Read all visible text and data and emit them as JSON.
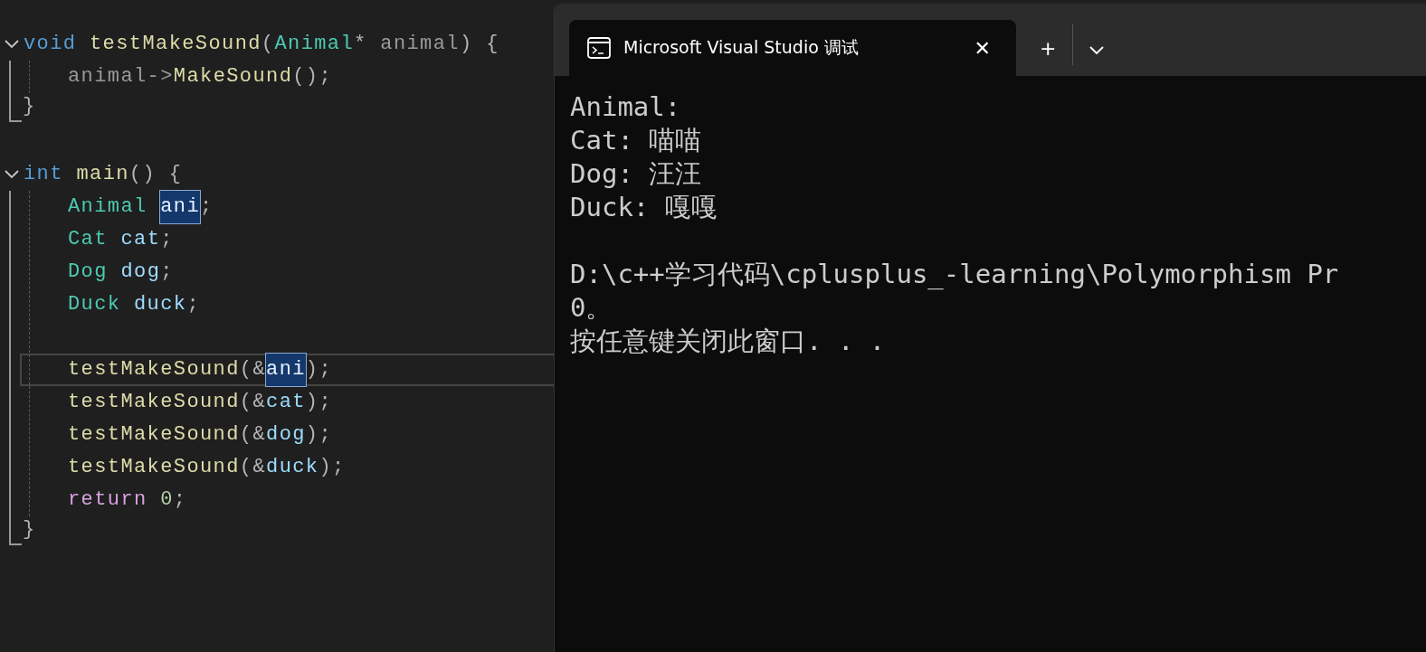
{
  "editor": {
    "blocks": [
      {
        "expanded": true,
        "header": [
          {
            "text": "void ",
            "kind": "keyword",
            "highlighted": false
          },
          {
            "text": "testMakeSound",
            "kind": "function",
            "highlighted": false
          },
          {
            "text": "(",
            "kind": "punct",
            "highlighted": false
          },
          {
            "text": "Animal",
            "kind": "type",
            "highlighted": false
          },
          {
            "text": "* ",
            "kind": "punct",
            "highlighted": false
          },
          {
            "text": "animal",
            "kind": "param",
            "highlighted": false
          },
          {
            "text": ") {",
            "kind": "punct",
            "highlighted": false
          }
        ],
        "body": [
          {
            "kind": "code",
            "current": false,
            "tokens": [
              {
                "text": "animal->",
                "kind": "param",
                "highlighted": false
              },
              {
                "text": "MakeSound",
                "kind": "function",
                "highlighted": false
              },
              {
                "text": "();",
                "kind": "punct",
                "highlighted": false
              }
            ]
          }
        ],
        "footer": "}"
      },
      {
        "expanded": true,
        "header": [
          {
            "text": "int ",
            "kind": "keyword",
            "highlighted": false
          },
          {
            "text": "main",
            "kind": "function",
            "highlighted": false
          },
          {
            "text": "() {",
            "kind": "punct",
            "highlighted": false
          }
        ],
        "body": [
          {
            "kind": "code",
            "current": false,
            "tokens": [
              {
                "text": "Animal ",
                "kind": "type",
                "highlighted": false
              },
              {
                "text": "ani",
                "kind": "variable",
                "highlighted": true
              },
              {
                "text": ";",
                "kind": "punct",
                "highlighted": false
              }
            ]
          },
          {
            "kind": "code",
            "current": false,
            "tokens": [
              {
                "text": "Cat ",
                "kind": "type",
                "highlighted": false
              },
              {
                "text": "cat",
                "kind": "variable",
                "highlighted": false
              },
              {
                "text": ";",
                "kind": "punct",
                "highlighted": false
              }
            ]
          },
          {
            "kind": "code",
            "current": false,
            "tokens": [
              {
                "text": "Dog ",
                "kind": "type",
                "highlighted": false
              },
              {
                "text": "dog",
                "kind": "variable",
                "highlighted": false
              },
              {
                "text": ";",
                "kind": "punct",
                "highlighted": false
              }
            ]
          },
          {
            "kind": "code",
            "current": false,
            "tokens": [
              {
                "text": "Duck ",
                "kind": "type",
                "highlighted": false
              },
              {
                "text": "duck",
                "kind": "variable",
                "highlighted": false
              },
              {
                "text": ";",
                "kind": "punct",
                "highlighted": false
              }
            ]
          },
          {
            "kind": "blank",
            "current": false
          },
          {
            "kind": "code",
            "current": true,
            "tokens": [
              {
                "text": "testMakeSound",
                "kind": "function",
                "highlighted": false
              },
              {
                "text": "(&",
                "kind": "punct",
                "highlighted": false
              },
              {
                "text": "ani",
                "kind": "variable",
                "highlighted": true
              },
              {
                "text": ");",
                "kind": "punct",
                "highlighted": false
              }
            ]
          },
          {
            "kind": "code",
            "current": false,
            "tokens": [
              {
                "text": "testMakeSound",
                "kind": "function",
                "highlighted": false
              },
              {
                "text": "(&",
                "kind": "punct",
                "highlighted": false
              },
              {
                "text": "cat",
                "kind": "variable",
                "highlighted": false
              },
              {
                "text": ");",
                "kind": "punct",
                "highlighted": false
              }
            ]
          },
          {
            "kind": "code",
            "current": false,
            "tokens": [
              {
                "text": "testMakeSound",
                "kind": "function",
                "highlighted": false
              },
              {
                "text": "(&",
                "kind": "punct",
                "highlighted": false
              },
              {
                "text": "dog",
                "kind": "variable",
                "highlighted": false
              },
              {
                "text": ");",
                "kind": "punct",
                "highlighted": false
              }
            ]
          },
          {
            "kind": "code",
            "current": false,
            "tokens": [
              {
                "text": "testMakeSound",
                "kind": "function",
                "highlighted": false
              },
              {
                "text": "(&",
                "kind": "punct",
                "highlighted": false
              },
              {
                "text": "duck",
                "kind": "variable",
                "highlighted": false
              },
              {
                "text": ");",
                "kind": "punct",
                "highlighted": false
              }
            ]
          },
          {
            "kind": "code",
            "current": false,
            "tokens": [
              {
                "text": "return ",
                "kind": "control",
                "highlighted": false
              },
              {
                "text": "0",
                "kind": "number",
                "highlighted": false
              },
              {
                "text": ";",
                "kind": "punct",
                "highlighted": false
              }
            ]
          }
        ],
        "footer": "}"
      }
    ]
  },
  "terminal": {
    "tab": {
      "title": "Microsoft Visual Studio 调试",
      "selected": true,
      "close": "✕"
    },
    "new_tab": "+",
    "output": [
      {
        "kind": "text",
        "text": "Animal:"
      },
      {
        "kind": "text",
        "text": "Cat: 喵喵"
      },
      {
        "kind": "text",
        "text": "Dog: 汪汪"
      },
      {
        "kind": "text",
        "text": "Duck: 嘎嘎"
      },
      {
        "kind": "blank"
      },
      {
        "kind": "text",
        "text": "D:\\c++学习代码\\cplusplus_-learning\\Polymorphism Pr"
      },
      {
        "kind": "text",
        "text": "0。"
      },
      {
        "kind": "text",
        "text": "按任意键关闭此窗口. . ."
      }
    ]
  }
}
